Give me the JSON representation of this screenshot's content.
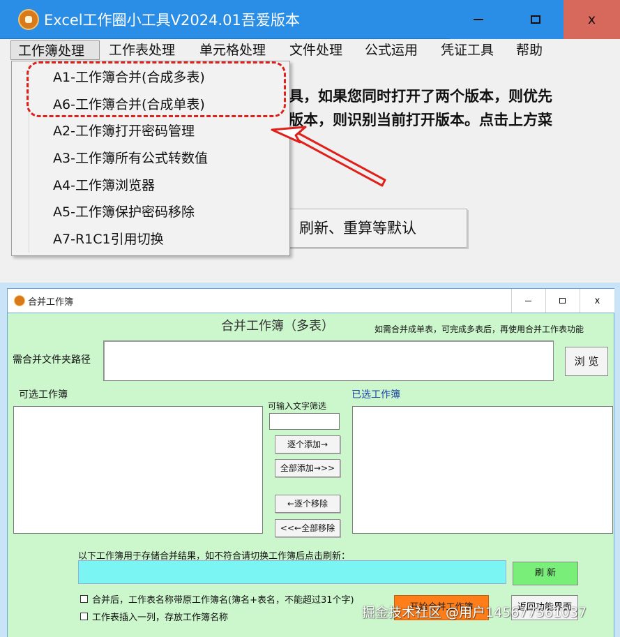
{
  "top_window": {
    "title": "Excel工作圈小工具V2024.01吾爱版本",
    "menu": [
      "工作簿处理",
      "工作表处理",
      "单元格处理",
      "文件处理",
      "公式运用",
      "凭证工具",
      "帮助"
    ],
    "dropdown_items": [
      "A1-工作簿合并(合成多表)",
      "A6-工作簿合并(合成单表)",
      "A2-工作簿打开密码管理",
      "A3-工作簿所有公式转数值",
      "A4-工作簿浏览器",
      "A5-工作簿保护密码移除",
      "A7-R1C1引用切换"
    ],
    "background_text_line1": "具，如果您同时打开了两个版本，则优先",
    "background_text_line2": "版本，则识别当前打开版本。点击上方菜",
    "background_button": "刷新、重算等默认",
    "colors": {
      "titlebar": "#2b8ee6",
      "close_button": "#d7685c",
      "highlight": "#e0201a"
    }
  },
  "bottom_window": {
    "title": "合并工作簿",
    "form_title": "合并工作簿（多表）",
    "hint": "如需合并成单表，可完成多表后，再使用合并工作表功能",
    "path_label": "需合并文件夹路径",
    "browse_button": "浏 览",
    "available_label": "可选工作簿",
    "selected_label": "已选工作簿",
    "filter_label": "可输入文字筛选",
    "buttons": {
      "add_one": "逐个添加→",
      "add_all": "全部添加→>>",
      "remove_one": "←逐个移除",
      "remove_all": "<<←全部移除",
      "refresh": "刷 新",
      "merge": "开始合并工作簿",
      "back": "返回功能界面"
    },
    "store_label": "以下工作簿用于存储合并结果，如不符合请切换工作簿后点击刷新：",
    "checkbox_1": "合并后，工作表名称带原工作簿名(簿名+表名，不能超过31个字)",
    "checkbox_2": "工作表插入一列，存放工作簿名称",
    "colors": {
      "body": "#ccf7cc",
      "store_field": "#7bf4f4",
      "refresh_button": "#79ee79",
      "merge_button": "#ff7e1a"
    }
  },
  "watermark": "掘金技术社区 @用户1456775610",
  "watermark_end": "37",
  "window_controls": {
    "minimize": "minimize-icon",
    "maximize": "maximize-icon",
    "close": "close-icon",
    "close_glyph": "x"
  }
}
